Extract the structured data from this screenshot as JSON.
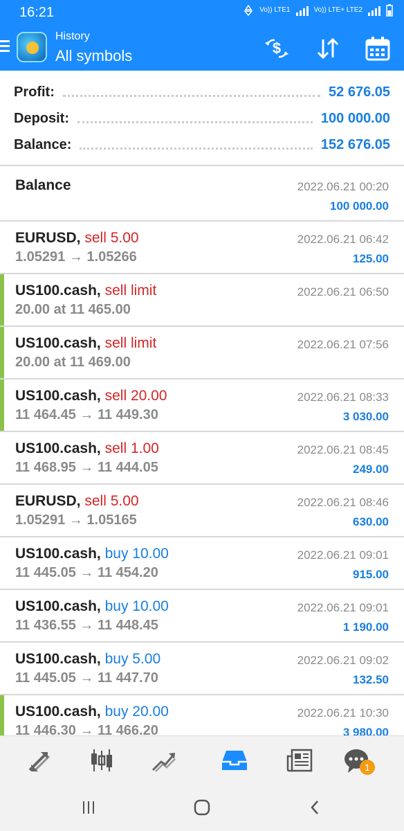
{
  "status": {
    "time": "16:21",
    "sim1": "Vo)) LTE1",
    "sim2": "Vo)) LTE+ LTE2"
  },
  "appbar": {
    "subtitle": "History",
    "title": "All symbols"
  },
  "summary": [
    {
      "label": "Profit:",
      "value": "52 676.05"
    },
    {
      "label": "Deposit:",
      "value": "100 000.00"
    },
    {
      "label": "Balance:",
      "value": "152 676.05"
    }
  ],
  "balance_entry": {
    "title": "Balance",
    "date": "2022.06.21 00:20",
    "amount": "100 000.00"
  },
  "deals": [
    {
      "symbol": "EURUSD,",
      "op": "sell 5.00",
      "side": "sell",
      "prices": "1.05291 → 1.05266",
      "date": "2022.06.21 06:42",
      "profit": "125.00",
      "accent": false
    },
    {
      "symbol": "US100.cash,",
      "op": "sell limit",
      "side": "sell",
      "prices": "20.00 at 11 465.00",
      "date": "2022.06.21 06:50",
      "profit": "",
      "accent": true
    },
    {
      "symbol": "US100.cash,",
      "op": "sell limit",
      "side": "sell",
      "prices": "20.00 at 11 469.00",
      "date": "2022.06.21 07:56",
      "profit": "",
      "accent": true
    },
    {
      "symbol": "US100.cash,",
      "op": "sell 20.00",
      "side": "sell",
      "prices": "11 464.45 → 11 449.30",
      "date": "2022.06.21 08:33",
      "profit": "3 030.00",
      "accent": true
    },
    {
      "symbol": "US100.cash,",
      "op": "sell 1.00",
      "side": "sell",
      "prices": "11 468.95 → 11 444.05",
      "date": "2022.06.21 08:45",
      "profit": "249.00",
      "accent": false
    },
    {
      "symbol": "EURUSD,",
      "op": "sell 5.00",
      "side": "sell",
      "prices": "1.05291 → 1.05165",
      "date": "2022.06.21 08:46",
      "profit": "630.00",
      "accent": false
    },
    {
      "symbol": "US100.cash,",
      "op": "buy 10.00",
      "side": "buy",
      "prices": "11 445.05 → 11 454.20",
      "date": "2022.06.21 09:01",
      "profit": "915.00",
      "accent": false
    },
    {
      "symbol": "US100.cash,",
      "op": "buy 10.00",
      "side": "buy",
      "prices": "11 436.55 → 11 448.45",
      "date": "2022.06.21 09:01",
      "profit": "1 190.00",
      "accent": false
    },
    {
      "symbol": "US100.cash,",
      "op": "buy 5.00",
      "side": "buy",
      "prices": "11 445.05 → 11 447.70",
      "date": "2022.06.21 09:02",
      "profit": "132.50",
      "accent": false
    },
    {
      "symbol": "US100.cash,",
      "op": "buy 20.00",
      "side": "buy",
      "prices": "11 446.30 → 11 466.20",
      "date": "2022.06.21 10:30",
      "profit": "3 980.00",
      "accent": true
    }
  ],
  "bottomnav": {
    "chat_badge": "1"
  },
  "colors": {
    "primary": "#1a8cff",
    "profit": "#1a7fe0",
    "sell": "#d32626",
    "accent": "#8bc34a"
  },
  "icons": [
    "menu-icon",
    "app-logo",
    "currency-exchange-icon",
    "sort-icon",
    "calendar-icon",
    "quotes-icon",
    "chart-icon",
    "trade-icon",
    "history-icon",
    "news-icon",
    "chat-icon",
    "recents-icon",
    "home-icon",
    "back-icon"
  ]
}
